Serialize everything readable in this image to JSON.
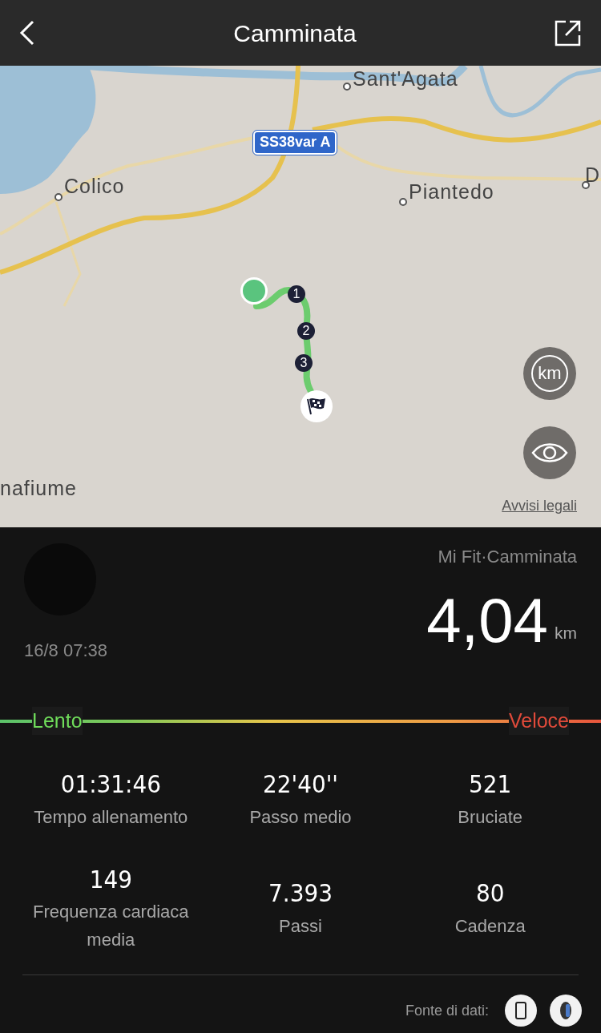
{
  "header": {
    "title": "Camminata"
  },
  "map": {
    "labels": [
      {
        "text": "Sant'Agata"
      },
      {
        "text": "Colico"
      },
      {
        "text": "Piantedo"
      },
      {
        "text": "D"
      },
      {
        "text": "nafiume"
      }
    ],
    "road_badge": "SS38var A",
    "route_markers": [
      "1",
      "2",
      "3"
    ],
    "buttons": [
      {
        "kind": "unit",
        "label": "km"
      },
      {
        "kind": "view"
      }
    ],
    "legal_link": "Avvisi legali"
  },
  "summary": {
    "source": "Mi Fit·Camminata",
    "date": "16/8 07:38",
    "distance": "4,04",
    "unit": "km"
  },
  "speed_scale": {
    "slow": "Lento",
    "fast": "Veloce"
  },
  "stats": [
    {
      "value": "01:31:46",
      "label": "Tempo allenamento"
    },
    {
      "value": "22'40''",
      "label": "Passo medio"
    },
    {
      "value": "521",
      "label": "Bruciate"
    },
    {
      "value": "149",
      "label": "Frequenza cardiaca media"
    },
    {
      "value": "7.393",
      "label": "Passi"
    },
    {
      "value": "80",
      "label": "Cadenza"
    }
  ],
  "footer": {
    "label": "Fonte di dati:",
    "sources": [
      {
        "kind": "phone"
      },
      {
        "kind": "band"
      }
    ]
  }
}
